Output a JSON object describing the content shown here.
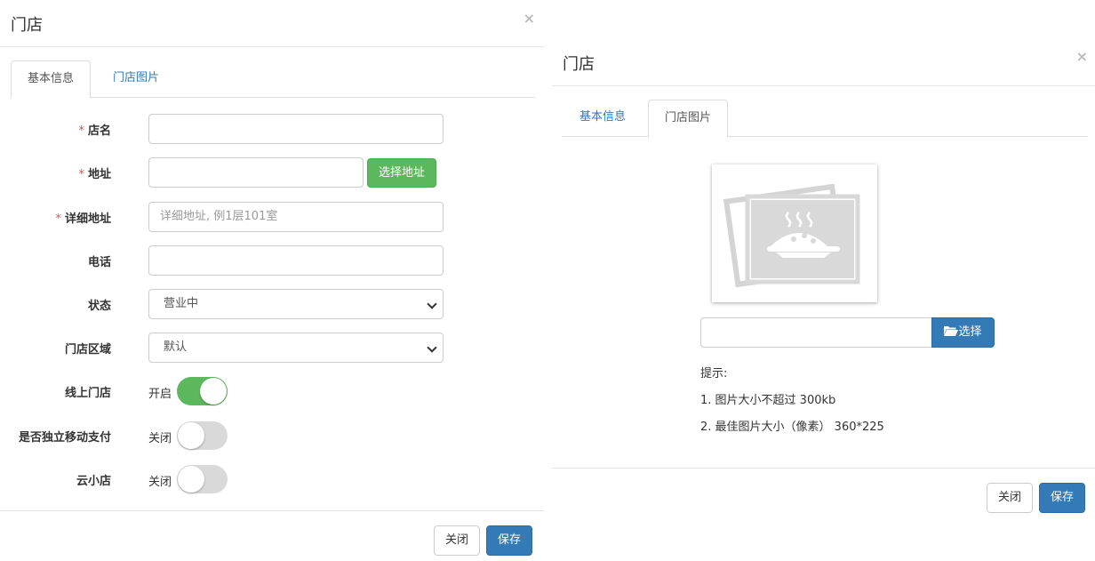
{
  "left_modal": {
    "title": "门店",
    "close_glyph": "×",
    "tabs": [
      {
        "label": "基本信息",
        "active": true
      },
      {
        "label": "门店图片",
        "active": false
      }
    ],
    "fields": {
      "name": {
        "label": "店名",
        "required_mark": "*",
        "value": ""
      },
      "address": {
        "label": "地址",
        "required_mark": "*",
        "value": "",
        "button": "选择地址"
      },
      "detail_address": {
        "label": "详细地址",
        "required_mark": "*",
        "value": "",
        "placeholder": "详细地址, 例1层101室"
      },
      "phone": {
        "label": "电话",
        "value": ""
      },
      "status": {
        "label": "状态",
        "selected": "营业中"
      },
      "area": {
        "label": "门店区域",
        "selected": "默认"
      },
      "online_store": {
        "label": "线上门店",
        "state_text": "开启",
        "on": true
      },
      "mobile_pay": {
        "label": "是否独立移动支付",
        "state_text": "关闭",
        "on": false
      },
      "cloud_store": {
        "label": "云小店",
        "state_text": "关闭",
        "on": false
      }
    },
    "footer": {
      "close_label": "关闭",
      "save_label": "保存"
    }
  },
  "right_modal": {
    "title": "门店",
    "close_glyph": "×",
    "tabs": [
      {
        "label": "基本信息",
        "active": false
      },
      {
        "label": "门店图片",
        "active": true
      }
    ],
    "image_placeholder_icon": "food-image-placeholder-icon",
    "file_value": "",
    "choose_button": "选择",
    "choose_icon": "folder-open-icon",
    "tips": {
      "heading": "提示:",
      "line1": "1. 图片大小不超过 300kb",
      "line2": "2. 最佳图片大小（像素） 360*225"
    },
    "footer": {
      "close_label": "关闭",
      "save_label": "保存"
    }
  },
  "colors": {
    "primary": "#337ab7",
    "success": "#5cb85c",
    "required": "#d9534f"
  }
}
